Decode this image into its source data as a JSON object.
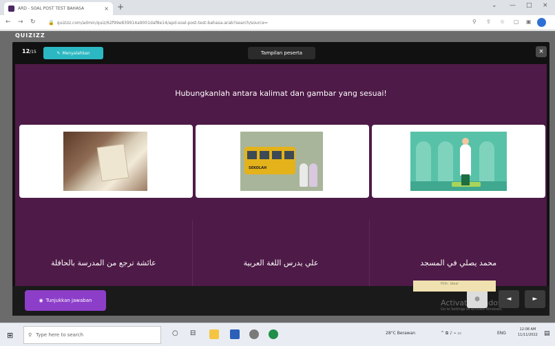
{
  "browser": {
    "tab_title": "ARD - SOAL POST TEST BAHASA",
    "tab_close": "×",
    "new_tab": "+",
    "window_controls": [
      "⌄",
      "—",
      "□",
      "×"
    ],
    "url": "quizizz.com/admin/quiz/62f99e839914a9001daf8e14/apd-soal-post-test-bahasa-arab?search/source=",
    "nav": {
      "back": "←",
      "forward": "→",
      "reload": "↻"
    }
  },
  "app": {
    "brand": "QUIZIZZ",
    "question_counter": "12",
    "question_total": "/15",
    "edit_label": "Menyalahkan",
    "preview_title": "Tampilan peserta",
    "close_label": "×"
  },
  "question": {
    "prompt": "Hubungkanlah antara kalimat dan gambar yang sesuai!",
    "images": [
      "quran-reading-image",
      "school-bus-image",
      "praying-in-mosque-image"
    ],
    "options": [
      "عائشة ترجع من المدرسة بالحافلة",
      "علي يدرس اللغة العربية",
      "محمد يصلي في المسجد"
    ]
  },
  "footer": {
    "show_answer_label": "Tunjukkan jawaban",
    "prev_label": "◄",
    "next_label": "►",
    "watermark_title": "Activate Windows",
    "watermark_sub": "Go to Settings to activate Windows.",
    "page_strip": "Pilih: Ideal"
  },
  "taskbar": {
    "search_placeholder": "Type here to search",
    "weather": "28°C Berawan",
    "lang": "ENG",
    "time": "12:08 AM",
    "date": "11/11/2022"
  },
  "colors": {
    "stage": "#4e1a47",
    "accent_teal": "#2cb8c2",
    "show_answer": "#8d3ec9"
  }
}
